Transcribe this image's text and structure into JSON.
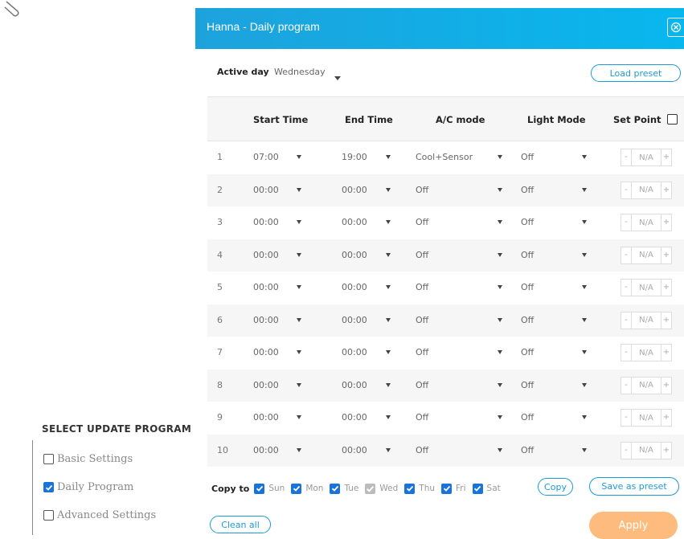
{
  "side_panel": {
    "title": "SELECT UPDATE PROGRAM",
    "items": [
      {
        "label": "Basic Settings",
        "checked": false
      },
      {
        "label": "Daily Program",
        "checked": true
      },
      {
        "label": "Advanced Settings",
        "checked": false
      }
    ]
  },
  "dialog": {
    "title": "Hanna - Daily program",
    "active_day_label": "Active day",
    "active_day_value": "Wednesday",
    "load_preset_label": "Load preset",
    "columns": [
      "Start Time",
      "End Time",
      "A/C mode",
      "Light Mode",
      "Set Point"
    ],
    "rows": [
      {
        "num": "1",
        "start": "07:00",
        "end": "19:00",
        "ac": "Cool+Sensor",
        "light": "Off",
        "set_point": "N/A"
      },
      {
        "num": "2",
        "start": "00:00",
        "end": "00:00",
        "ac": "Off",
        "light": "Off",
        "set_point": "N/A"
      },
      {
        "num": "3",
        "start": "00:00",
        "end": "00:00",
        "ac": "Off",
        "light": "Off",
        "set_point": "N/A"
      },
      {
        "num": "4",
        "start": "00:00",
        "end": "00:00",
        "ac": "Off",
        "light": "Off",
        "set_point": "N/A"
      },
      {
        "num": "5",
        "start": "00:00",
        "end": "00:00",
        "ac": "Off",
        "light": "Off",
        "set_point": "N/A"
      },
      {
        "num": "6",
        "start": "00:00",
        "end": "00:00",
        "ac": "Off",
        "light": "Off",
        "set_point": "N/A"
      },
      {
        "num": "7",
        "start": "00:00",
        "end": "00:00",
        "ac": "Off",
        "light": "Off",
        "set_point": "N/A"
      },
      {
        "num": "8",
        "start": "00:00",
        "end": "00:00",
        "ac": "Off",
        "light": "Off",
        "set_point": "N/A"
      },
      {
        "num": "9",
        "start": "00:00",
        "end": "00:00",
        "ac": "Off",
        "light": "Off",
        "set_point": "N/A"
      },
      {
        "num": "10",
        "start": "00:00",
        "end": "00:00",
        "ac": "Off",
        "light": "Off",
        "set_point": "N/A"
      }
    ],
    "stepper_minus": "-",
    "stepper_plus": "+",
    "copy_to_label": "Copy to",
    "days": [
      {
        "label": "Sun",
        "checked": true,
        "disabled": false
      },
      {
        "label": "Mon",
        "checked": true,
        "disabled": false
      },
      {
        "label": "Tue",
        "checked": true,
        "disabled": false
      },
      {
        "label": "Wed",
        "checked": true,
        "disabled": true
      },
      {
        "label": "Thu",
        "checked": true,
        "disabled": false
      },
      {
        "label": "Fri",
        "checked": true,
        "disabled": false
      },
      {
        "label": "Sat",
        "checked": true,
        "disabled": false
      }
    ],
    "copy_label": "Copy",
    "save_preset_label": "Save as preset",
    "clean_all_label": "Clean all",
    "apply_label": "Apply"
  },
  "colors": {
    "header_start": "#1ea2dc",
    "header_end": "#08b7ee",
    "accent": "#1a9bd7",
    "checkbox": "#1a73d9",
    "apply": "#fdbb7e"
  }
}
